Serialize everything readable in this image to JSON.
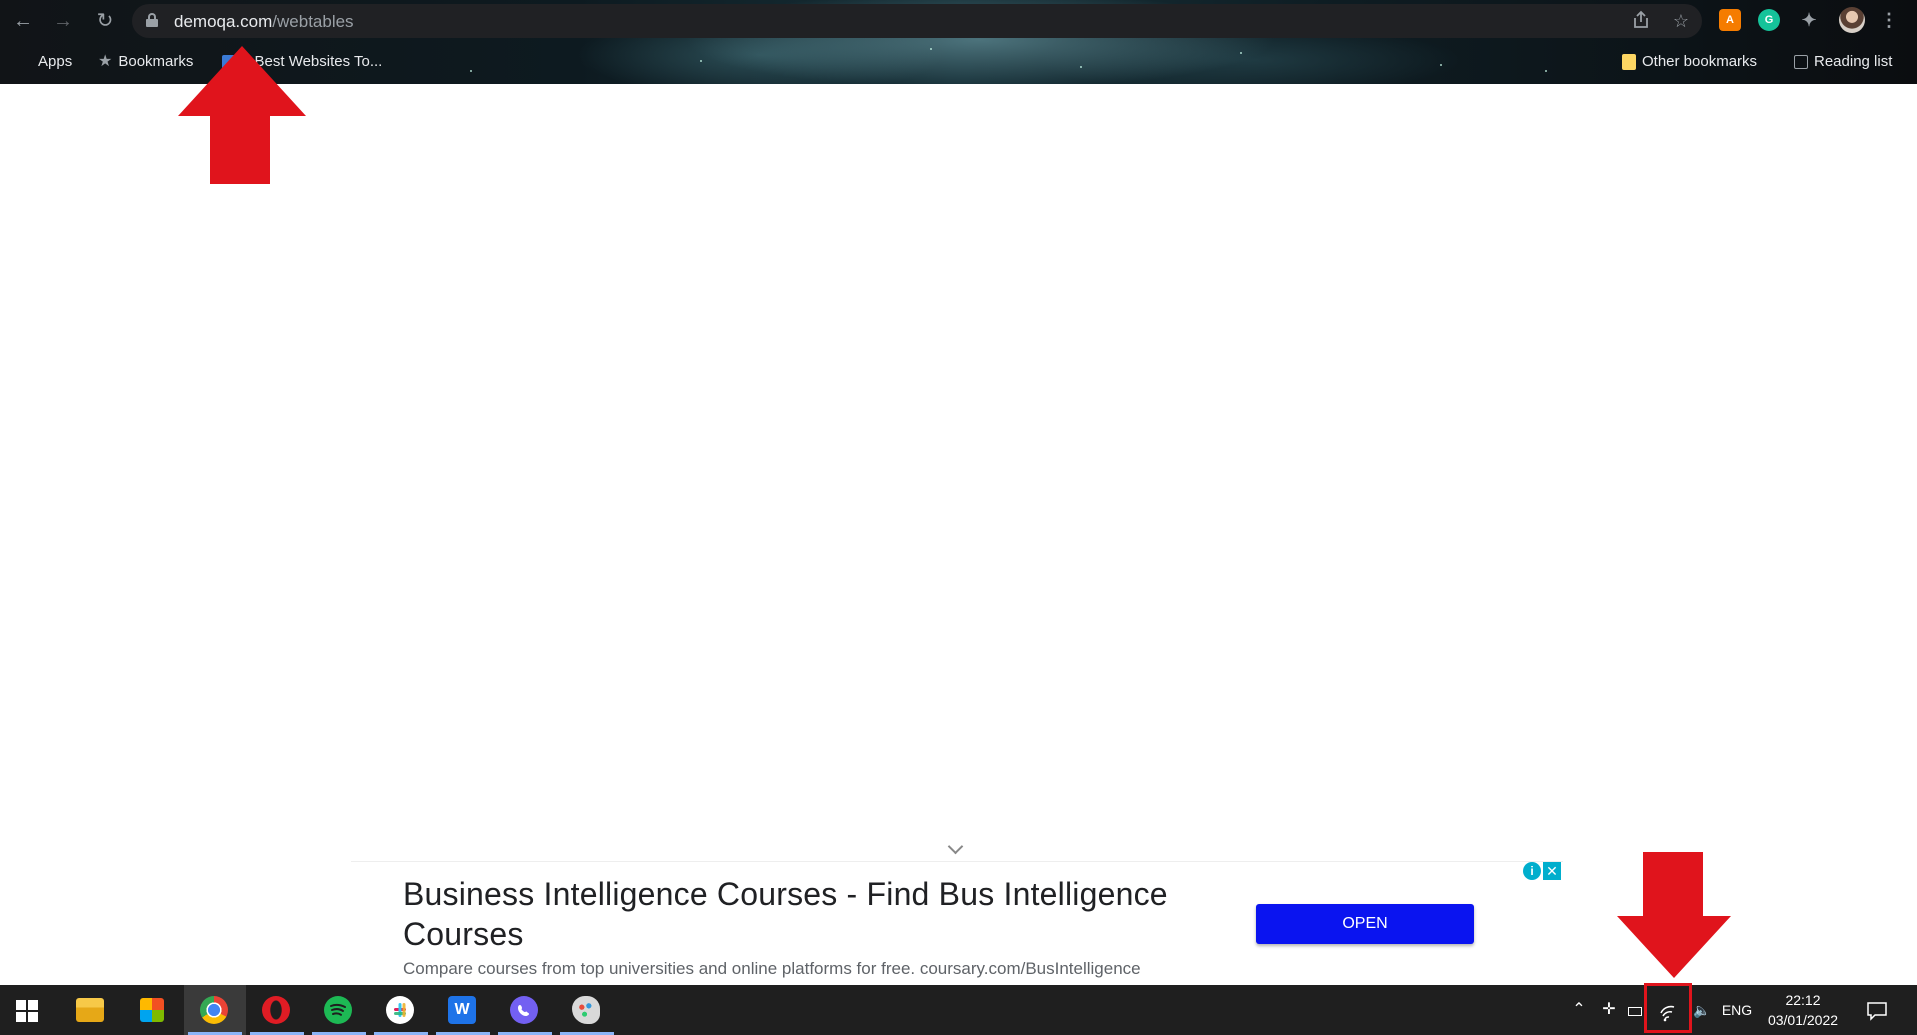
{
  "browser": {
    "url_host": "demoqa.com",
    "url_path": "/webtables",
    "bookmarks": {
      "apps_label": "Apps",
      "bookmarks_label": "Bookmarks",
      "best_websites_label": "0 Best Websites To...",
      "other_bookmarks_label": "Other bookmarks",
      "reading_list_label": "Reading list"
    },
    "extensions": {
      "ext_a_label": "A",
      "grammarly_label": "G"
    }
  },
  "ad": {
    "title": "Business Intelligence Courses - Find Bus Intelligence Courses",
    "description": "Compare courses from top universities and online platforms for free. coursary.com/BusIntelligence",
    "open_label": "OPEN",
    "info_label": "i",
    "close_label": "✕"
  },
  "taskbar": {
    "language": "ENG",
    "time": "22:12",
    "date": "03/01/2022"
  },
  "colors": {
    "annotation_red": "#e0141c",
    "ad_button_blue": "#0a14f0",
    "taskbar_bg": "#1f1f1f"
  }
}
